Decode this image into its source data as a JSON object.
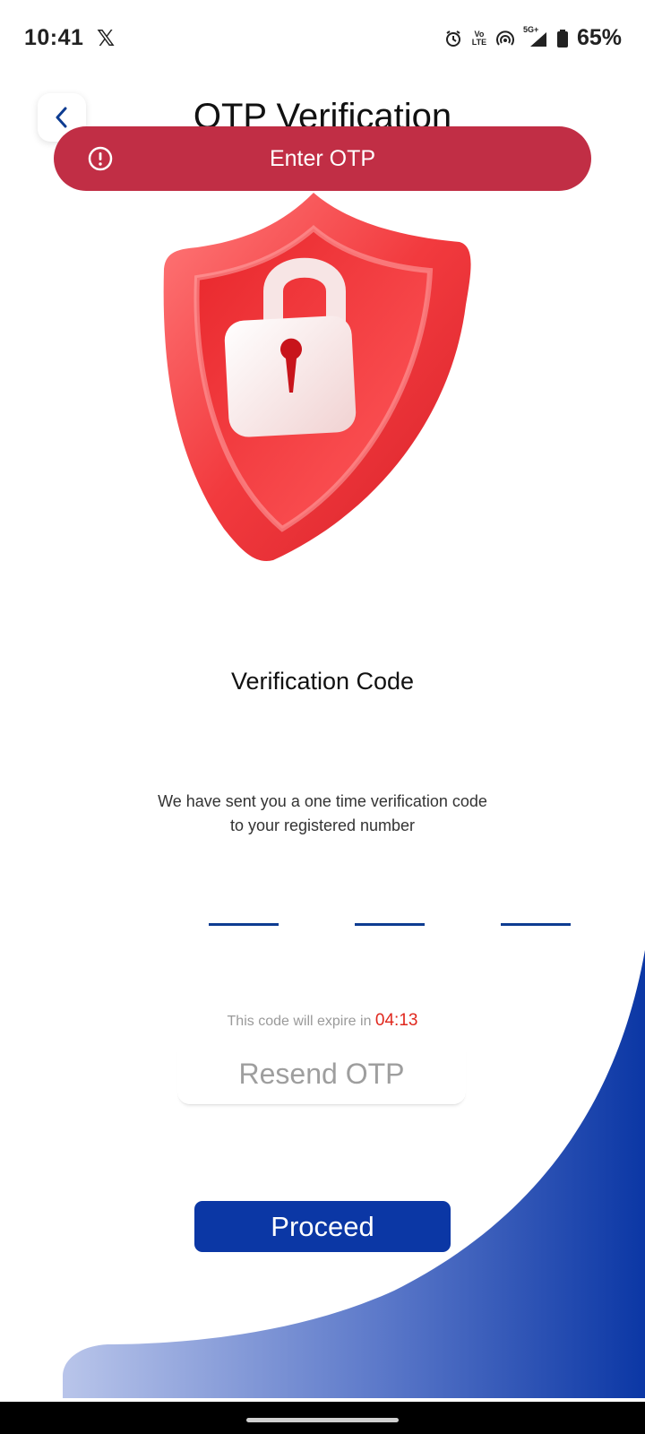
{
  "status_bar": {
    "time": "10:41",
    "battery": "65%",
    "network": "5G+",
    "volte": "Vo LTE"
  },
  "header": {
    "title": "OTP Verification",
    "back_icon": "chevron-left-icon"
  },
  "toast": {
    "message": "Enter OTP",
    "icon": "alert-circle-icon",
    "color": "#c12e45"
  },
  "illustration": {
    "icon": "shield-lock-icon"
  },
  "main": {
    "heading": "Verification Code",
    "description_line1": "We have sent you a one time verification code",
    "description_line2": "to your registered number",
    "otp_fields": [
      "",
      "",
      ""
    ],
    "expire_label": "This code will expire in",
    "timer": "04:13",
    "resend_label": "Resend OTP",
    "proceed_label": "Proceed"
  },
  "colors": {
    "primary": "#0b37a5",
    "timer": "#e0271d",
    "otp_underline": "#0d3c91"
  }
}
